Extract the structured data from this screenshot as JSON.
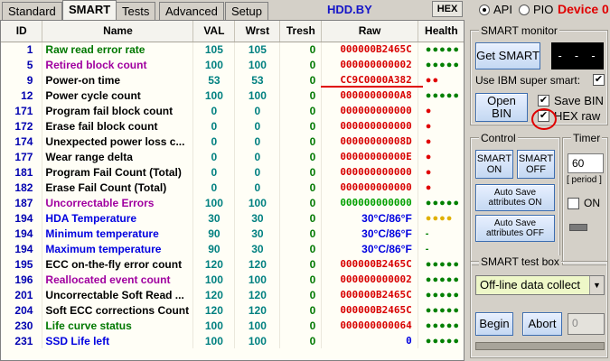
{
  "tabs": [
    "Standard",
    "SMART",
    "Tests",
    "Advanced",
    "Setup"
  ],
  "active_tab": "SMART",
  "brand": "HDD.BY",
  "hex_button": "HEX",
  "mode_api": "API",
  "mode_pio": "PIO",
  "device_label": "Device 0",
  "table": {
    "headers": [
      "ID",
      "Name",
      "VAL",
      "Wrst",
      "Tresh",
      "Raw",
      "Health"
    ],
    "rows": [
      {
        "id": "1",
        "name": "Raw read error rate",
        "val": "105",
        "wrst": "105",
        "tresh": "0",
        "raw": "000000B2465C",
        "health": "●●●●●"
      },
      {
        "id": "5",
        "name": "Retired block count",
        "val": "100",
        "wrst": "100",
        "tresh": "0",
        "raw": "000000000002",
        "health": "●●●●●"
      },
      {
        "id": "9",
        "name": "Power-on time",
        "val": "53",
        "wrst": "53",
        "tresh": "0",
        "raw": "CC9C0000A382",
        "health": "●●"
      },
      {
        "id": "12",
        "name": "Power cycle count",
        "val": "100",
        "wrst": "100",
        "tresh": "0",
        "raw": "0000000000A8",
        "health": "●●●●●"
      },
      {
        "id": "171",
        "name": "Program fail block count",
        "val": "0",
        "wrst": "0",
        "tresh": "0",
        "raw": "000000000000",
        "health": "●"
      },
      {
        "id": "172",
        "name": "Erase fail block count",
        "val": "0",
        "wrst": "0",
        "tresh": "0",
        "raw": "000000000000",
        "health": "●"
      },
      {
        "id": "174",
        "name": "Unexpected power loss c...",
        "val": "0",
        "wrst": "0",
        "tresh": "0",
        "raw": "00000000008D",
        "health": "●"
      },
      {
        "id": "177",
        "name": "Wear range delta",
        "val": "0",
        "wrst": "0",
        "tresh": "0",
        "raw": "00000000000E",
        "health": "●"
      },
      {
        "id": "181",
        "name": "Program Fail Count (Total)",
        "val": "0",
        "wrst": "0",
        "tresh": "0",
        "raw": "000000000000",
        "health": "●"
      },
      {
        "id": "182",
        "name": "Erase Fail Count (Total)",
        "val": "0",
        "wrst": "0",
        "tresh": "0",
        "raw": "000000000000",
        "health": "●"
      },
      {
        "id": "187",
        "name": "Uncorrectable Errors",
        "val": "100",
        "wrst": "100",
        "tresh": "0",
        "raw": "000000000000",
        "health": "●●●●●"
      },
      {
        "id": "194",
        "name": "HDA Temperature",
        "val": "30",
        "wrst": "30",
        "tresh": "0",
        "raw": "30°C/86°F",
        "health": "●●●●"
      },
      {
        "id": "194",
        "name": "Minimum temperature",
        "val": "90",
        "wrst": "30",
        "tresh": "0",
        "raw": "30°C/86°F",
        "health": "-"
      },
      {
        "id": "194",
        "name": "Maximum temperature",
        "val": "90",
        "wrst": "30",
        "tresh": "0",
        "raw": "30°C/86°F",
        "health": "-"
      },
      {
        "id": "195",
        "name": "ECC on-the-fly error count",
        "val": "120",
        "wrst": "120",
        "tresh": "0",
        "raw": "000000B2465C",
        "health": "●●●●●"
      },
      {
        "id": "196",
        "name": "Reallocated event count",
        "val": "100",
        "wrst": "100",
        "tresh": "0",
        "raw": "000000000002",
        "health": "●●●●●"
      },
      {
        "id": "201",
        "name": "Uncorrectable Soft Read ...",
        "val": "120",
        "wrst": "120",
        "tresh": "0",
        "raw": "000000B2465C",
        "health": "●●●●●"
      },
      {
        "id": "204",
        "name": "Soft ECC corrections Count",
        "val": "120",
        "wrst": "120",
        "tresh": "0",
        "raw": "000000B2465C",
        "health": "●●●●●"
      },
      {
        "id": "230",
        "name": "Life curve status",
        "val": "100",
        "wrst": "100",
        "tresh": "0",
        "raw": "000000000064",
        "health": "●●●●●"
      },
      {
        "id": "231",
        "name": "SSD Life left",
        "val": "100",
        "wrst": "100",
        "tresh": "0",
        "raw": "0",
        "health": "●●●●●"
      }
    ]
  },
  "smart_monitor": {
    "title": "SMART monitor",
    "get_smart": "Get SMART",
    "display": "- - - -",
    "use_ibm": "Use IBM super smart:",
    "open_bin": "Open BIN",
    "save_bin": "Save BIN",
    "hex_raw": "HEX raw"
  },
  "control": {
    "title": "Control",
    "smart_on": "SMART ON",
    "smart_off": "SMART OFF",
    "autosave_on": "Auto Save attributes ON",
    "autosave_off": "Auto Save attributes OFF"
  },
  "timer": {
    "title": "Timer",
    "value": "60",
    "period_label": "[ period ]",
    "on_label": "ON"
  },
  "test_box": {
    "title": "SMART test box",
    "selected": "Off-line data collect",
    "begin": "Begin",
    "abort": "Abort",
    "count": "0"
  },
  "colors": {
    "name_green": "#007800",
    "name_purple": "#a000a0",
    "name_blue": "#0000e0",
    "raw_red": "#d80000",
    "health_green": "#008000",
    "health_red": "#e00000",
    "health_yellow": "#e0b000"
  }
}
